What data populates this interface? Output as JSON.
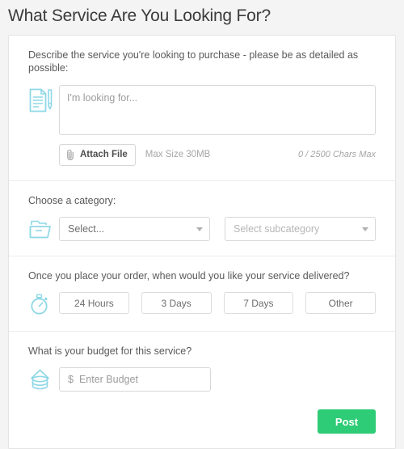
{
  "page": {
    "title": "What Service Are You Looking For?",
    "background": "#f4f4f4",
    "accent_icon_color": "#8ed8e6",
    "accent_button_color": "#2ecc76"
  },
  "describe_section": {
    "prompt": "Describe the service you're looking to purchase - please be as detailed as possible:",
    "icon": "document-pen-icon",
    "textarea_placeholder": "I'm looking for...",
    "textarea_value": "",
    "attach_button_label": "Attach File",
    "attach_icon": "paperclip-icon",
    "max_size_note": "Max Size 30MB",
    "char_counter": "0 / 2500 Chars Max"
  },
  "category_section": {
    "prompt": "Choose a category:",
    "icon": "folder-icon",
    "category_select": {
      "value": "Select...",
      "options": [
        "Select..."
      ]
    },
    "subcategory_select": {
      "value": "Select subcategory",
      "options": [
        "Select subcategory"
      ]
    }
  },
  "delivery_section": {
    "prompt": "Once you place your order, when would you like your service delivered?",
    "icon": "stopwatch-icon",
    "options": [
      {
        "label": "24 Hours"
      },
      {
        "label": "3 Days"
      },
      {
        "label": "7 Days"
      },
      {
        "label": "Other"
      }
    ]
  },
  "budget_section": {
    "prompt": "What is your budget for this service?",
    "icon": "coins-icon",
    "currency_symbol": "$",
    "input_placeholder": "Enter Budget",
    "input_value": ""
  },
  "footer": {
    "post_label": "Post"
  }
}
